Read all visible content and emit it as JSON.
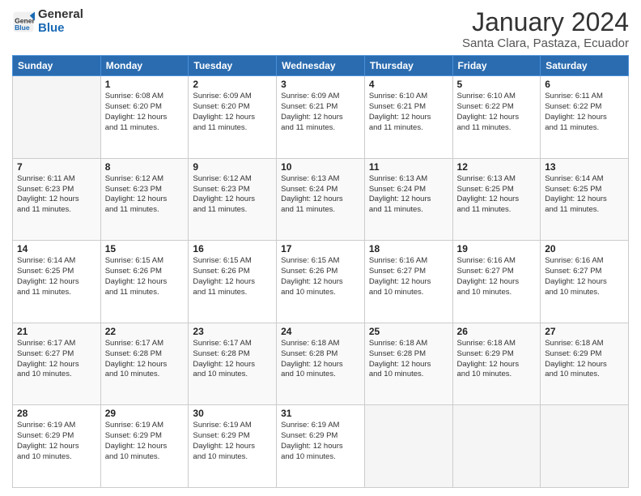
{
  "header": {
    "logo_line1": "General",
    "logo_line2": "Blue",
    "month": "January 2024",
    "location": "Santa Clara, Pastaza, Ecuador"
  },
  "days_of_week": [
    "Sunday",
    "Monday",
    "Tuesday",
    "Wednesday",
    "Thursday",
    "Friday",
    "Saturday"
  ],
  "weeks": [
    [
      {
        "num": "",
        "info": ""
      },
      {
        "num": "1",
        "info": "Sunrise: 6:08 AM\nSunset: 6:20 PM\nDaylight: 12 hours\nand 11 minutes."
      },
      {
        "num": "2",
        "info": "Sunrise: 6:09 AM\nSunset: 6:20 PM\nDaylight: 12 hours\nand 11 minutes."
      },
      {
        "num": "3",
        "info": "Sunrise: 6:09 AM\nSunset: 6:21 PM\nDaylight: 12 hours\nand 11 minutes."
      },
      {
        "num": "4",
        "info": "Sunrise: 6:10 AM\nSunset: 6:21 PM\nDaylight: 12 hours\nand 11 minutes."
      },
      {
        "num": "5",
        "info": "Sunrise: 6:10 AM\nSunset: 6:22 PM\nDaylight: 12 hours\nand 11 minutes."
      },
      {
        "num": "6",
        "info": "Sunrise: 6:11 AM\nSunset: 6:22 PM\nDaylight: 12 hours\nand 11 minutes."
      }
    ],
    [
      {
        "num": "7",
        "info": "Sunrise: 6:11 AM\nSunset: 6:23 PM\nDaylight: 12 hours\nand 11 minutes."
      },
      {
        "num": "8",
        "info": "Sunrise: 6:12 AM\nSunset: 6:23 PM\nDaylight: 12 hours\nand 11 minutes."
      },
      {
        "num": "9",
        "info": "Sunrise: 6:12 AM\nSunset: 6:23 PM\nDaylight: 12 hours\nand 11 minutes."
      },
      {
        "num": "10",
        "info": "Sunrise: 6:13 AM\nSunset: 6:24 PM\nDaylight: 12 hours\nand 11 minutes."
      },
      {
        "num": "11",
        "info": "Sunrise: 6:13 AM\nSunset: 6:24 PM\nDaylight: 12 hours\nand 11 minutes."
      },
      {
        "num": "12",
        "info": "Sunrise: 6:13 AM\nSunset: 6:25 PM\nDaylight: 12 hours\nand 11 minutes."
      },
      {
        "num": "13",
        "info": "Sunrise: 6:14 AM\nSunset: 6:25 PM\nDaylight: 12 hours\nand 11 minutes."
      }
    ],
    [
      {
        "num": "14",
        "info": "Sunrise: 6:14 AM\nSunset: 6:25 PM\nDaylight: 12 hours\nand 11 minutes."
      },
      {
        "num": "15",
        "info": "Sunrise: 6:15 AM\nSunset: 6:26 PM\nDaylight: 12 hours\nand 11 minutes."
      },
      {
        "num": "16",
        "info": "Sunrise: 6:15 AM\nSunset: 6:26 PM\nDaylight: 12 hours\nand 11 minutes."
      },
      {
        "num": "17",
        "info": "Sunrise: 6:15 AM\nSunset: 6:26 PM\nDaylight: 12 hours\nand 10 minutes."
      },
      {
        "num": "18",
        "info": "Sunrise: 6:16 AM\nSunset: 6:27 PM\nDaylight: 12 hours\nand 10 minutes."
      },
      {
        "num": "19",
        "info": "Sunrise: 6:16 AM\nSunset: 6:27 PM\nDaylight: 12 hours\nand 10 minutes."
      },
      {
        "num": "20",
        "info": "Sunrise: 6:16 AM\nSunset: 6:27 PM\nDaylight: 12 hours\nand 10 minutes."
      }
    ],
    [
      {
        "num": "21",
        "info": "Sunrise: 6:17 AM\nSunset: 6:27 PM\nDaylight: 12 hours\nand 10 minutes."
      },
      {
        "num": "22",
        "info": "Sunrise: 6:17 AM\nSunset: 6:28 PM\nDaylight: 12 hours\nand 10 minutes."
      },
      {
        "num": "23",
        "info": "Sunrise: 6:17 AM\nSunset: 6:28 PM\nDaylight: 12 hours\nand 10 minutes."
      },
      {
        "num": "24",
        "info": "Sunrise: 6:18 AM\nSunset: 6:28 PM\nDaylight: 12 hours\nand 10 minutes."
      },
      {
        "num": "25",
        "info": "Sunrise: 6:18 AM\nSunset: 6:28 PM\nDaylight: 12 hours\nand 10 minutes."
      },
      {
        "num": "26",
        "info": "Sunrise: 6:18 AM\nSunset: 6:29 PM\nDaylight: 12 hours\nand 10 minutes."
      },
      {
        "num": "27",
        "info": "Sunrise: 6:18 AM\nSunset: 6:29 PM\nDaylight: 12 hours\nand 10 minutes."
      }
    ],
    [
      {
        "num": "28",
        "info": "Sunrise: 6:19 AM\nSunset: 6:29 PM\nDaylight: 12 hours\nand 10 minutes."
      },
      {
        "num": "29",
        "info": "Sunrise: 6:19 AM\nSunset: 6:29 PM\nDaylight: 12 hours\nand 10 minutes."
      },
      {
        "num": "30",
        "info": "Sunrise: 6:19 AM\nSunset: 6:29 PM\nDaylight: 12 hours\nand 10 minutes."
      },
      {
        "num": "31",
        "info": "Sunrise: 6:19 AM\nSunset: 6:29 PM\nDaylight: 12 hours\nand 10 minutes."
      },
      {
        "num": "",
        "info": ""
      },
      {
        "num": "",
        "info": ""
      },
      {
        "num": "",
        "info": ""
      }
    ]
  ]
}
